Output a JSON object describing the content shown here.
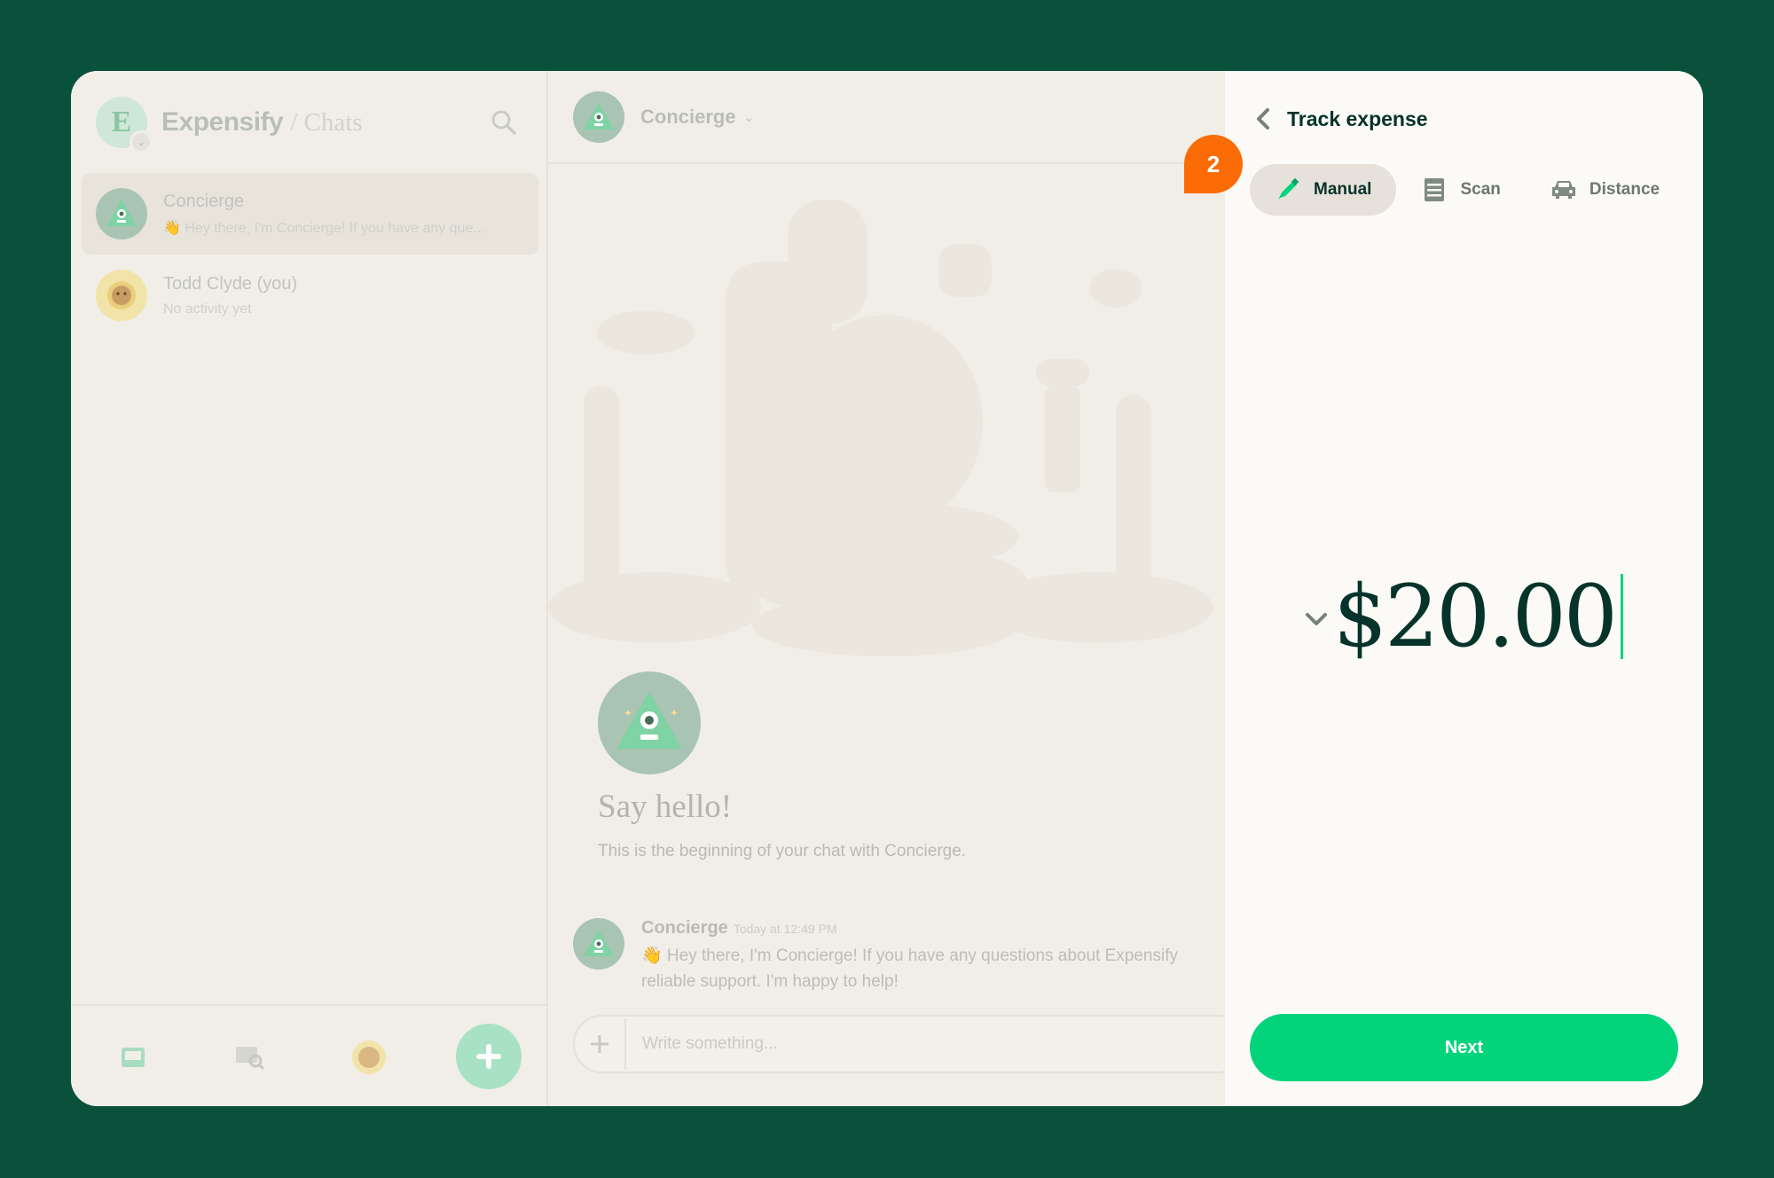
{
  "sidebar": {
    "brand": "Expensify",
    "section": "/ Chats",
    "chats": [
      {
        "name": "Concierge",
        "preview": "👋 Hey there, I'm Concierge! If you have any que..."
      },
      {
        "name": "Todd Clyde (you)",
        "preview": "No activity yet"
      }
    ]
  },
  "chat": {
    "title": "Concierge",
    "hello_title": "Say hello!",
    "hello_subtitle": "This is the beginning of your chat with Concierge.",
    "message": {
      "author": "Concierge",
      "time": "Today at 12:49 PM",
      "line1": "👋 Hey there, I'm Concierge! If you have any questions about Expensify",
      "line2": "reliable support. I'm happy to help!"
    },
    "composer_placeholder": "Write something..."
  },
  "panel": {
    "title": "Track expense",
    "step_badge": "2",
    "tabs": [
      {
        "label": "Manual",
        "icon": "pencil-icon",
        "active": true
      },
      {
        "label": "Scan",
        "icon": "receipt-icon",
        "active": false
      },
      {
        "label": "Distance",
        "icon": "car-icon",
        "active": false
      }
    ],
    "amount": "$20.00",
    "next_label": "Next"
  },
  "colors": {
    "background": "#0a513b",
    "accent_green": "#03d47c",
    "badge_orange": "#fb6c07",
    "text_dark": "#06332a"
  }
}
